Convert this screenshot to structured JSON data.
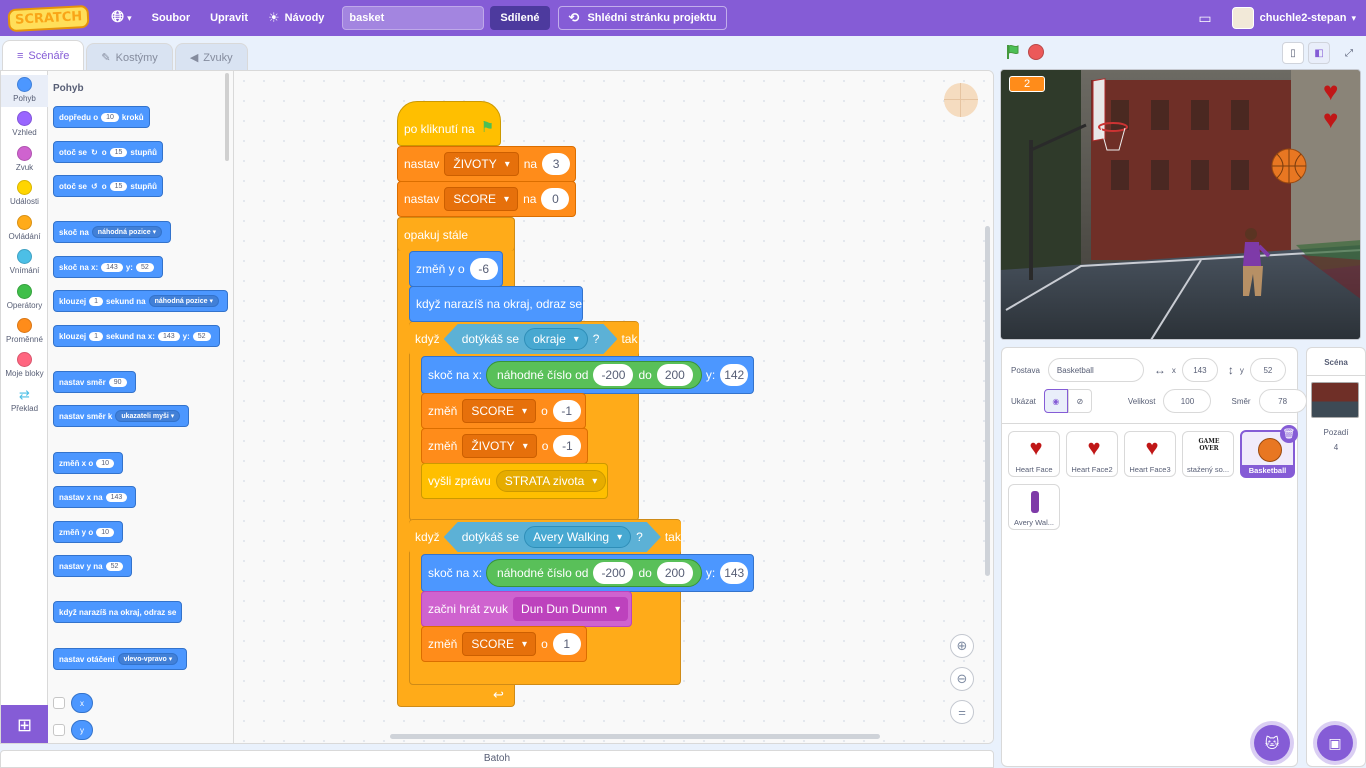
{
  "menu": {
    "logo": "SCRATCH",
    "file": "Soubor",
    "edit": "Upravit",
    "tutorials": "Návody",
    "project_title": "basket",
    "share": "Sdílené",
    "see_project": "Shlédni stránku projektu",
    "username": "chuchle2-stepan"
  },
  "tabs": {
    "code": "Scénáře",
    "costumes": "Kostýmy",
    "sounds": "Zvuky"
  },
  "categories": [
    {
      "label": "Pohyb",
      "color": "#4c97ff"
    },
    {
      "label": "Vzhled",
      "color": "#9966ff"
    },
    {
      "label": "Zvuk",
      "color": "#cf63cf"
    },
    {
      "label": "Události",
      "color": "#ffd500"
    },
    {
      "label": "Ovládání",
      "color": "#ffab19"
    },
    {
      "label": "Vnímání",
      "color": "#4cbfe6"
    },
    {
      "label": "Operátory",
      "color": "#40bf4a"
    },
    {
      "label": "Proměnné",
      "color": "#ff8c1a"
    },
    {
      "label": "Moje bloky",
      "color": "#ff6680"
    },
    {
      "label": "Překlad",
      "color": "#ffffff"
    }
  ],
  "palette": {
    "heading": "Pohyb",
    "b1": {
      "a": "dopředu o",
      "v": "10",
      "b": "kroků"
    },
    "b2": {
      "a": "otoč se",
      "c": "o",
      "v": "15",
      "b": "stupňů"
    },
    "b3": {
      "a": "otoč se",
      "c": "o",
      "v": "15",
      "b": "stupňů"
    },
    "b4": {
      "a": "skoč na",
      "d": "náhodná pozice"
    },
    "b5": {
      "a": "skoč na x:",
      "v1": "143",
      "b": "y:",
      "v2": "52"
    },
    "b6": {
      "a": "klouzej",
      "v": "1",
      "b": "sekund na",
      "d": "náhodná pozice"
    },
    "b7": {
      "a": "klouzej",
      "v": "1",
      "b": "sekund na x:",
      "v1": "143",
      "c": "y:",
      "v2": "52"
    },
    "b8": {
      "a": "nastav směr",
      "v": "90"
    },
    "b9": {
      "a": "nastav směr k",
      "d": "ukazateli myši"
    },
    "b10": {
      "a": "změň x o",
      "v": "10"
    },
    "b11": {
      "a": "nastav x na",
      "v": "143"
    },
    "b12": {
      "a": "změň y o",
      "v": "10"
    },
    "b13": {
      "a": "nastav y na",
      "v": "52"
    },
    "b14": {
      "a": "když narazíš na okraj, odraz se"
    },
    "b15": {
      "a": "nastav otáčení",
      "d": "vlevo-vpravo"
    },
    "rep_x": "x",
    "rep_y": "y"
  },
  "script": {
    "hat": "po kliknutí na",
    "set1": {
      "a": "nastav",
      "var": "ŽIVOTY",
      "b": "na",
      "v": "3"
    },
    "set2": {
      "a": "nastav",
      "var": "SCORE",
      "b": "na",
      "v": "0"
    },
    "forever": "opakuj stále",
    "chy": {
      "a": "změň y o",
      "v": "-6"
    },
    "bounce": "když narazíš na okraj, odraz se",
    "if1": {
      "a": "když",
      "touch": "dotýkáš se",
      "obj": "okraje",
      "q": "?",
      "b": "tak"
    },
    "goto1": {
      "a": "skoč na x:",
      "rand": "náhodné číslo od",
      "lo": "-200",
      "do": "do",
      "hi": "200",
      "y": "y:",
      "yv": "142"
    },
    "ch1": {
      "a": "změň",
      "var": "SCORE",
      "b": "o",
      "v": "-1"
    },
    "ch2": {
      "a": "změň",
      "var": "ŽIVOTY",
      "b": "o",
      "v": "-1"
    },
    "bc": {
      "a": "vyšli zprávu",
      "msg": "STRATA zivota"
    },
    "if2": {
      "a": "když",
      "touch": "dotýkáš se",
      "obj": "Avery Walking",
      "q": "?",
      "b": "tak"
    },
    "goto2": {
      "a": "skoč na x:",
      "rand": "náhodné číslo od",
      "lo": "-200",
      "do": "do",
      "hi": "200",
      "y": "y:",
      "yv": "143"
    },
    "snd": {
      "a": "začni hrát zvuk",
      "s": "Dun Dun Dunnn"
    },
    "ch3": {
      "a": "změň",
      "var": "SCORE",
      "b": "o",
      "v": "1"
    }
  },
  "stage": {
    "score": "2"
  },
  "sprite_info": {
    "sprite_label": "Postava",
    "sprite_name": "Basketball",
    "x_label": "x",
    "x": "143",
    "y_label": "y",
    "y": "52",
    "show_label": "Ukázat",
    "size_label": "Velikost",
    "size": "100",
    "dir_label": "Směr",
    "dir": "78"
  },
  "sprites": [
    "Heart Face",
    "Heart Face2",
    "Heart Face3",
    "stažený so...",
    "Basketball",
    "Avery Wal..."
  ],
  "gameover": "GAME OVER",
  "stage_col": {
    "title": "Scéna",
    "backdrops_label": "Pozadí",
    "backdrops_count": "4"
  },
  "backpack": "Batoh"
}
